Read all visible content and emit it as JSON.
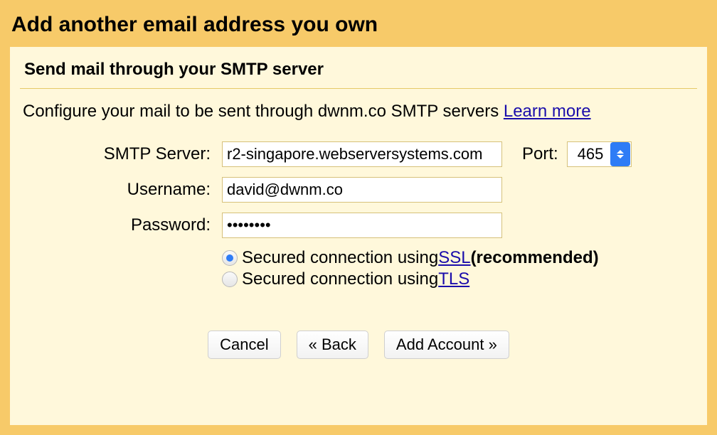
{
  "dialog": {
    "title": "Add another email address you own",
    "subtitle": "Send mail through your SMTP server"
  },
  "instruction": {
    "prefix": "Configure your mail to be sent through dwnm.co SMTP servers ",
    "link": "Learn more"
  },
  "form": {
    "smtp_label": "SMTP Server:",
    "smtp_value": "r2-singapore.webserversystems.com",
    "port_label": "Port:",
    "port_value": "465",
    "username_label": "Username:",
    "username_value": "david@dwnm.co",
    "password_label": "Password:",
    "password_value": "••••••••"
  },
  "security": {
    "ssl_prefix": "Secured connection using ",
    "ssl_link": "SSL",
    "ssl_suffix": " (recommended)",
    "tls_prefix": "Secured connection using ",
    "tls_link": "TLS"
  },
  "buttons": {
    "cancel": "Cancel",
    "back": "« Back",
    "add": "Add Account »"
  }
}
